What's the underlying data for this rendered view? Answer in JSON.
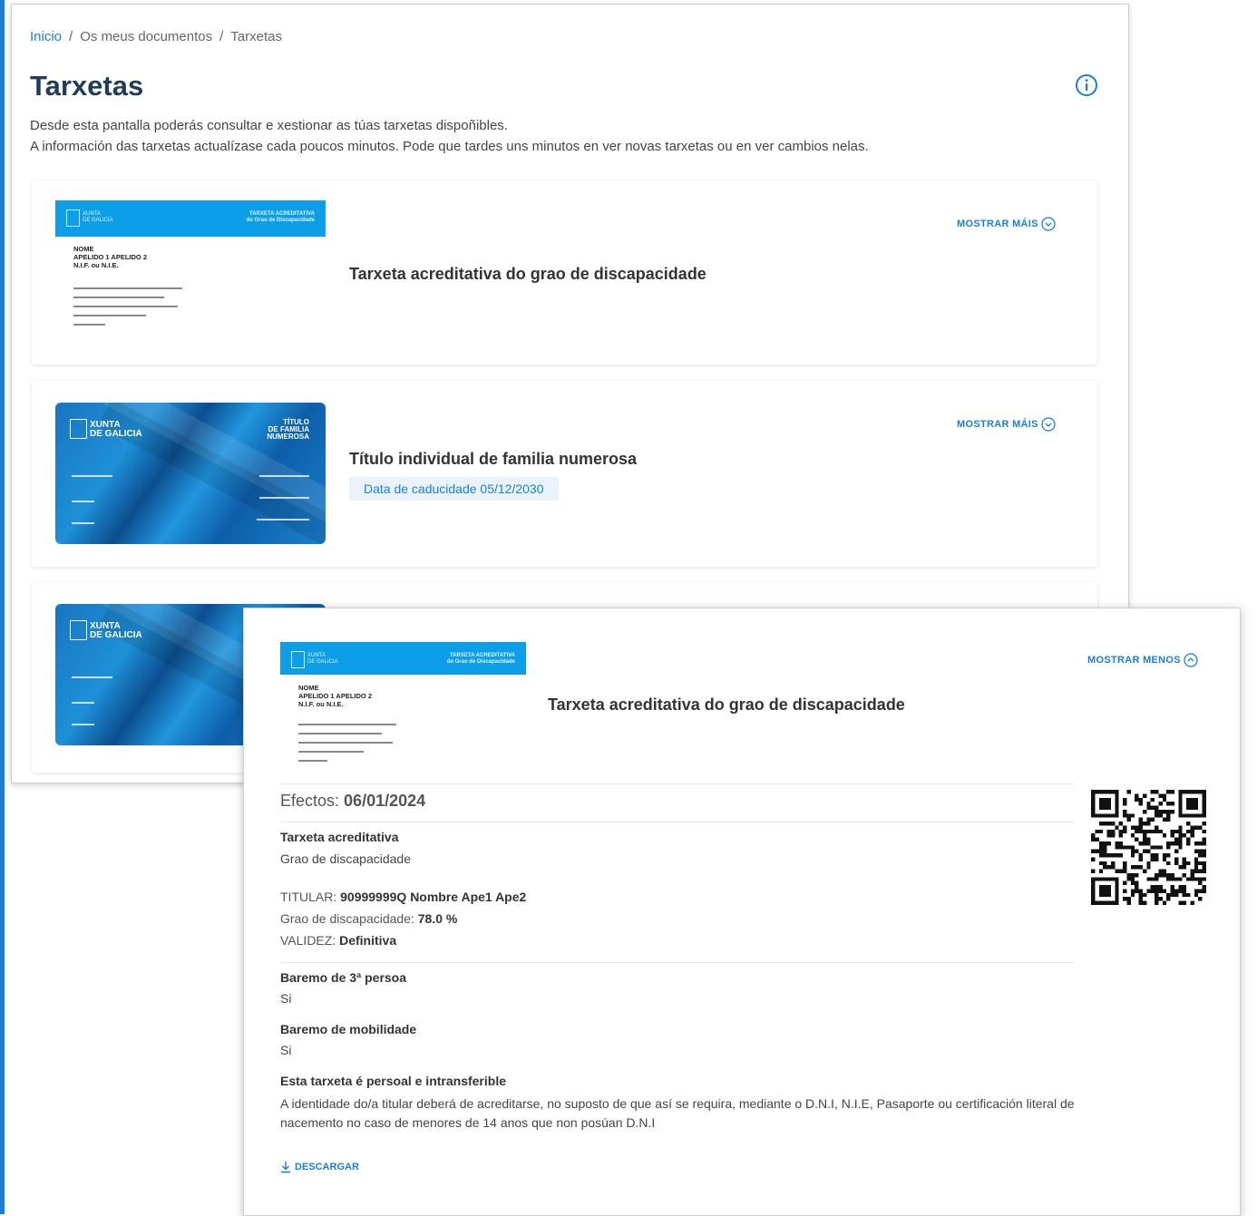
{
  "breadcrumb": {
    "home": "Inicio",
    "docs": "Os meus documentos",
    "current": "Tarxetas",
    "separator": "/"
  },
  "page": {
    "title": "Tarxetas",
    "intro_1": "Desde esta pantalla poderás consultar e xestionar as túas tarxetas dispoñibles.",
    "intro_2": "A información das tarxetas actualízase cada poucos minutos. Pode que tardes uns minutos en ver novas tarxetas ou en ver cambios nelas."
  },
  "cards": [
    {
      "title": "Tarxeta acreditativa do grao de discapacidade",
      "action": "MOSTRAR MÁIS"
    },
    {
      "title": "Título individual de familia numerosa",
      "action": "MOSTRAR MÁIS",
      "badge": "Data de caducidade 05/12/2030"
    }
  ],
  "disability_card_art": {
    "org": [
      "XUNTA",
      "DE GALICIA"
    ],
    "kind": [
      "TARXETA ACREDITATIVA",
      "do Grao de Discapacidade"
    ],
    "fields": [
      "NOME",
      "APELIDO 1 APELIDO 2",
      "N.I.F. ou N.I.E."
    ]
  },
  "family_card_art": {
    "org": [
      "XUNTA",
      "DE GALICIA"
    ],
    "kind": [
      "TÍTULO",
      "DE FAMILIA",
      "NUMEROSA"
    ]
  },
  "detail": {
    "title": "Tarxeta acreditativa do grao de discapacidade",
    "action": "MOSTRAR MENOS",
    "effects_label": "Efectos:",
    "effects_value": "06/01/2024",
    "card_type_title": "Tarxeta acreditativa",
    "card_type_value": "Grao de discapacidade",
    "holder_label": "TITULAR:",
    "holder_value": "90999999Q Nombre Ape1 Ape2",
    "degree_label": "Grao de discapacidade:",
    "degree_value": "78.0 %",
    "validity_label": "VALIDEZ:",
    "validity_value": "Definitiva",
    "third_person_title": "Baremo de 3ª persoa",
    "third_person_value": "Si",
    "mobility_title": "Baremo de mobilidade",
    "mobility_value": "Si",
    "personal_title": "Esta tarxeta é persoal e intransferible",
    "personal_text": "A identidade do/a titular deberá de acreditarse, no suposto de que así se requira, mediante o D.N.I, N.I.E, Pasaporte ou certificación literal de nacemento no caso de menores de 14 anos que non posúan D.N.I",
    "download": "DESCARGAR"
  },
  "colors": {
    "accent": "#1a7fd4",
    "title": "#1f3c5f",
    "card_band": "#0d9ee8"
  },
  "icons": {
    "info": "info-icon",
    "chevron": "chevron-circle-icon",
    "download": "download-icon",
    "qr": "qr-code-icon"
  }
}
